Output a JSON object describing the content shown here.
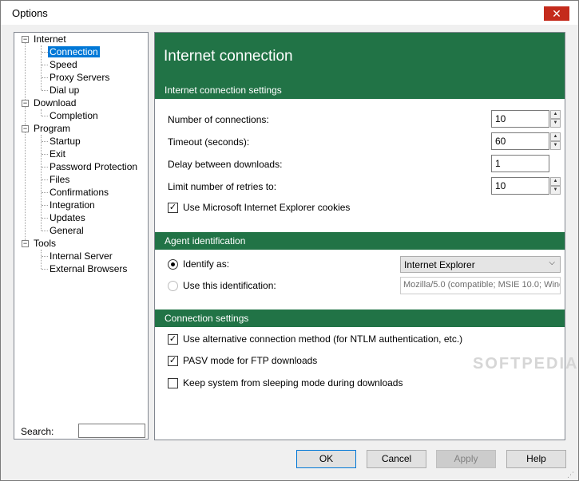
{
  "window": {
    "title": "Options",
    "close_glyph": "✕"
  },
  "tree": {
    "groups": [
      {
        "label": "Internet",
        "children": [
          "Connection",
          "Speed",
          "Proxy Servers",
          "Dial up"
        ]
      },
      {
        "label": "Download",
        "children": [
          "Completion"
        ]
      },
      {
        "label": "Program",
        "children": [
          "Startup",
          "Exit",
          "Password Protection",
          "Files",
          "Confirmations",
          "Integration",
          "Updates",
          "General"
        ]
      },
      {
        "label": "Tools",
        "children": [
          "Internal Server",
          "External Browsers"
        ]
      }
    ],
    "selected": "Connection",
    "search_label": "Search:",
    "search_value": ""
  },
  "panel": {
    "title": "Internet connection",
    "sections": {
      "settings": "Internet connection settings",
      "agent": "Agent identification",
      "connection": "Connection settings"
    },
    "fields": {
      "connections_label": "Number of connections:",
      "connections_value": "10",
      "timeout_label": "Timeout (seconds):",
      "timeout_value": "60",
      "delay_label": "Delay between downloads:",
      "delay_value": "1",
      "retries_label": "Limit number of retries to:",
      "retries_value": "10",
      "ie_cookies_label": "Use Microsoft Internet Explorer cookies",
      "ie_cookies_checked": true
    },
    "agent": {
      "identify_label": "Identify as:",
      "identify_value": "Internet Explorer",
      "custom_label": "Use this identification:",
      "custom_value": "Mozilla/5.0 (compatible; MSIE 10.0; Winc"
    },
    "connection": {
      "alt_method_label": "Use alternative connection method (for NTLM authentication, etc.)",
      "alt_method_checked": true,
      "pasv_label": "PASV mode for FTP downloads",
      "pasv_checked": true,
      "keep_awake_label": "Keep system from sleeping mode during downloads",
      "keep_awake_checked": false
    },
    "watermark": "SOFTPEDIA"
  },
  "buttons": {
    "ok": "OK",
    "cancel": "Cancel",
    "apply": "Apply",
    "help": "Help"
  },
  "icons": {
    "check": "✓",
    "chevron_down": "⌵",
    "expander": "−",
    "spin_up": "▲",
    "spin_down": "▼"
  },
  "colors": {
    "accent_green": "#217346",
    "selection_blue": "#0078d7",
    "close_red": "#c42b1c"
  }
}
